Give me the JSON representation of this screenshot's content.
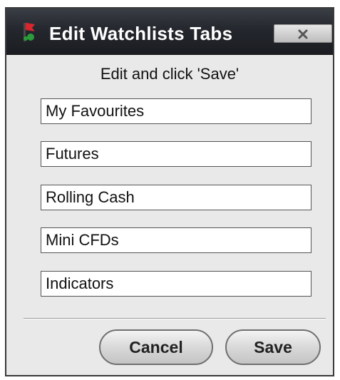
{
  "dialog": {
    "title": "Edit Watchlists Tabs",
    "app_icon": "flag-icon",
    "close_icon": "close-icon",
    "instruction": "Edit and click 'Save'"
  },
  "tabs": [
    {
      "value": "My Favourites"
    },
    {
      "value": "Futures"
    },
    {
      "value": "Rolling Cash"
    },
    {
      "value": "Mini CFDs"
    },
    {
      "value": "Indicators"
    }
  ],
  "buttons": {
    "cancel_label": "Cancel",
    "save_label": "Save"
  },
  "colors": {
    "titlebar": "#24272d",
    "dialog_background": "#e9e9e9",
    "icon_red": "#d8262e",
    "icon_green": "#2a9d3a"
  }
}
